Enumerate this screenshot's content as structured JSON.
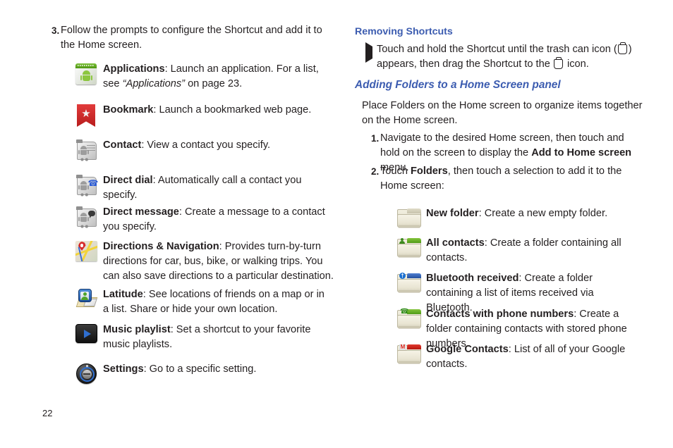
{
  "page_number": "22",
  "left_column": {
    "step": {
      "number": "3.",
      "text": "Follow the prompts to configure the Shortcut and add it to the Home screen."
    },
    "shortcut_items": [
      {
        "icon": "applications-icon",
        "title": "Applications",
        "desc_before": ": Launch an application. For a list, see ",
        "desc_italic": "“Applications”",
        "desc_after": " on page 23."
      },
      {
        "icon": "bookmark-icon",
        "title": "Bookmark",
        "desc_before": ": Launch a bookmarked web page.",
        "desc_italic": "",
        "desc_after": ""
      },
      {
        "icon": "contact-icon",
        "title": "Contact",
        "desc_before": ": View a contact you specify.",
        "desc_italic": "",
        "desc_after": ""
      },
      {
        "icon": "direct-dial-icon",
        "title": "Direct dial",
        "desc_before": ": Automatically call a contact you specify.",
        "desc_italic": "",
        "desc_after": ""
      },
      {
        "icon": "direct-message-icon",
        "title": "Direct message",
        "desc_before": ": Create a message to a contact you specify.",
        "desc_italic": "",
        "desc_after": ""
      },
      {
        "icon": "directions-navigation-icon",
        "title": "Directions & Navigation",
        "desc_before": ": Provides turn-by-turn directions for car, bus, bike, or walking trips. You can also save directions to a particular destination.",
        "desc_italic": "",
        "desc_after": ""
      },
      {
        "icon": "latitude-icon",
        "title": "Latitude",
        "desc_before": ": See locations of friends on a map or in a list. Share or hide your own location.",
        "desc_italic": "",
        "desc_after": ""
      },
      {
        "icon": "music-playlist-icon",
        "title": "Music playlist",
        "desc_before": ": Set a shortcut to your favorite music playlists.",
        "desc_italic": "",
        "desc_after": ""
      },
      {
        "icon": "settings-icon",
        "title": "Settings",
        "desc_before": ": Go to a specific setting.",
        "desc_italic": "",
        "desc_after": ""
      }
    ]
  },
  "right_column": {
    "heading_removing": "Removing Shortcuts",
    "bullet": {
      "part1": "Touch and hold the Shortcut until the trash can icon (",
      "part2": ") appears, then drag the Shortcut to the ",
      "part3": " icon."
    },
    "heading_adding": "Adding Folders to a Home Screen panel",
    "intro": "Place Folders on the Home screen to organize items together on the Home screen.",
    "steps": [
      {
        "number": "1.",
        "text_before": "Navigate to the desired Home screen, then touch and hold on the screen to display the ",
        "bold": "Add to Home screen",
        "text_after": " menu."
      },
      {
        "number": "2.",
        "text_before": "Touch ",
        "bold": "Folders",
        "text_after": ", then touch a selection to add it to the Home screen:"
      }
    ],
    "folder_items": [
      {
        "icon": "new-folder-icon",
        "title": "New folder",
        "desc": ": Create a new empty folder."
      },
      {
        "icon": "all-contacts-folder-icon",
        "title": "All contacts",
        "desc": ": Create a folder containing all contacts."
      },
      {
        "icon": "bluetooth-received-folder-icon",
        "title": "Bluetooth received",
        "desc": ": Create a folder containing a list of items received via Bluetooth."
      },
      {
        "icon": "contacts-with-phone-numbers-folder-icon",
        "title": "Contacts with phone numbers",
        "desc": ": Create a folder containing contacts with stored phone numbers."
      },
      {
        "icon": "google-contacts-folder-icon",
        "title": "Google Contacts",
        "desc": ": List of all of your Google contacts."
      }
    ]
  },
  "colors": {
    "heading_blue": "#3c5cb0",
    "body_text": "#231f20"
  }
}
